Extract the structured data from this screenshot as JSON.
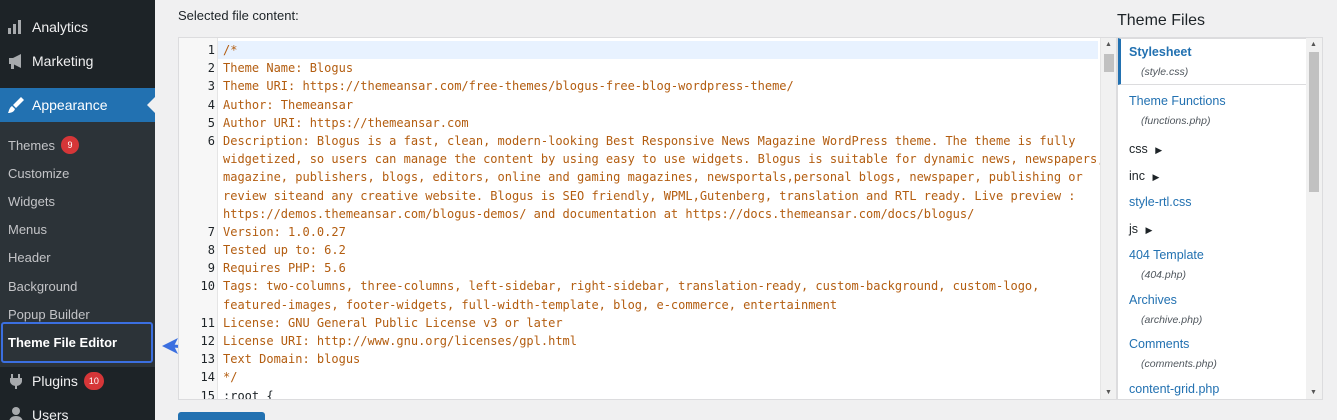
{
  "sidebar": {
    "top_items": [
      {
        "label": "Analytics",
        "icon": "bar-chart-icon"
      },
      {
        "label": "Marketing",
        "icon": "megaphone-icon"
      },
      {
        "label": "Appearance",
        "icon": "paintbrush-icon"
      }
    ],
    "submenu": [
      {
        "label": "Themes",
        "badge": "9"
      },
      {
        "label": "Customize"
      },
      {
        "label": "Widgets"
      },
      {
        "label": "Menus"
      },
      {
        "label": "Header"
      },
      {
        "label": "Background"
      },
      {
        "label": "Popup Builder"
      },
      {
        "label": "Theme File Editor"
      }
    ],
    "bottom_items": [
      {
        "label": "Plugins",
        "badge": "10",
        "icon": "plugin-icon"
      },
      {
        "label": "Users",
        "icon": "users-icon"
      }
    ],
    "accent": "#2271b1"
  },
  "main": {
    "selected_label": "Selected file content:",
    "lines": [
      {
        "n": "1",
        "t": "/*"
      },
      {
        "n": "2",
        "t": "Theme Name: Blogus"
      },
      {
        "n": "3",
        "t": "Theme URI: https://themeansar.com/free-themes/blogus-free-blog-wordpress-theme/"
      },
      {
        "n": "4",
        "t": "Author: Themeansar"
      },
      {
        "n": "5",
        "t": "Author URI: https://themeansar.com"
      },
      {
        "n": "6",
        "t": "Description: Blogus is a fast, clean, modern-looking Best Responsive News Magazine WordPress theme. The theme is fully"
      },
      {
        "n": "",
        "t": "widgetized, so users can manage the content by using easy to use widgets. Blogus is suitable for dynamic news, newspapers,"
      },
      {
        "n": "",
        "t": "magazine, publishers, blogs, editors, online and gaming magazines, newsportals,personal blogs, newspaper, publishing or"
      },
      {
        "n": "",
        "t": "review siteand any creative website. Blogus is SEO friendly, WPML,Gutenberg, translation and RTL ready. Live preview :"
      },
      {
        "n": "",
        "t": "https://demos.themeansar.com/blogus-demos/ and documentation at https://docs.themeansar.com/docs/blogus/"
      },
      {
        "n": "7",
        "t": "Version: 1.0.0.27"
      },
      {
        "n": "8",
        "t": "Tested up to: 6.2"
      },
      {
        "n": "9",
        "t": "Requires PHP: 5.6"
      },
      {
        "n": "10",
        "t": "Tags: two-columns, three-columns, left-sidebar, right-sidebar, translation-ready, custom-background, custom-logo,"
      },
      {
        "n": "",
        "t": "featured-images, footer-widgets, full-width-template, blog, e-commerce, entertainment"
      },
      {
        "n": "11",
        "t": "License: GNU General Public License v3 or later"
      },
      {
        "n": "12",
        "t": "License URI: http://www.gnu.org/licenses/gpl.html"
      },
      {
        "n": "13",
        "t": "Text Domain: blogus"
      },
      {
        "n": "14",
        "t": "*/"
      },
      {
        "n": "15",
        "t": ":root {"
      }
    ]
  },
  "theme_files": {
    "title": "Theme Files",
    "items": [
      {
        "label": "Stylesheet",
        "sub": "(style.css)",
        "kind": "file",
        "active": true
      },
      {
        "label": "Theme Functions",
        "sub": "(functions.php)",
        "kind": "file"
      },
      {
        "label": "css",
        "kind": "folder"
      },
      {
        "label": "inc",
        "kind": "folder"
      },
      {
        "label": "style-rtl.css",
        "kind": "file"
      },
      {
        "label": "js",
        "kind": "folder"
      },
      {
        "label": "404 Template",
        "sub": "(404.php)",
        "kind": "file"
      },
      {
        "label": "Archives",
        "sub": "(archive.php)",
        "kind": "file"
      },
      {
        "label": "Comments",
        "sub": "(comments.php)",
        "kind": "file"
      },
      {
        "label": "content-grid.php",
        "kind": "file"
      }
    ]
  }
}
